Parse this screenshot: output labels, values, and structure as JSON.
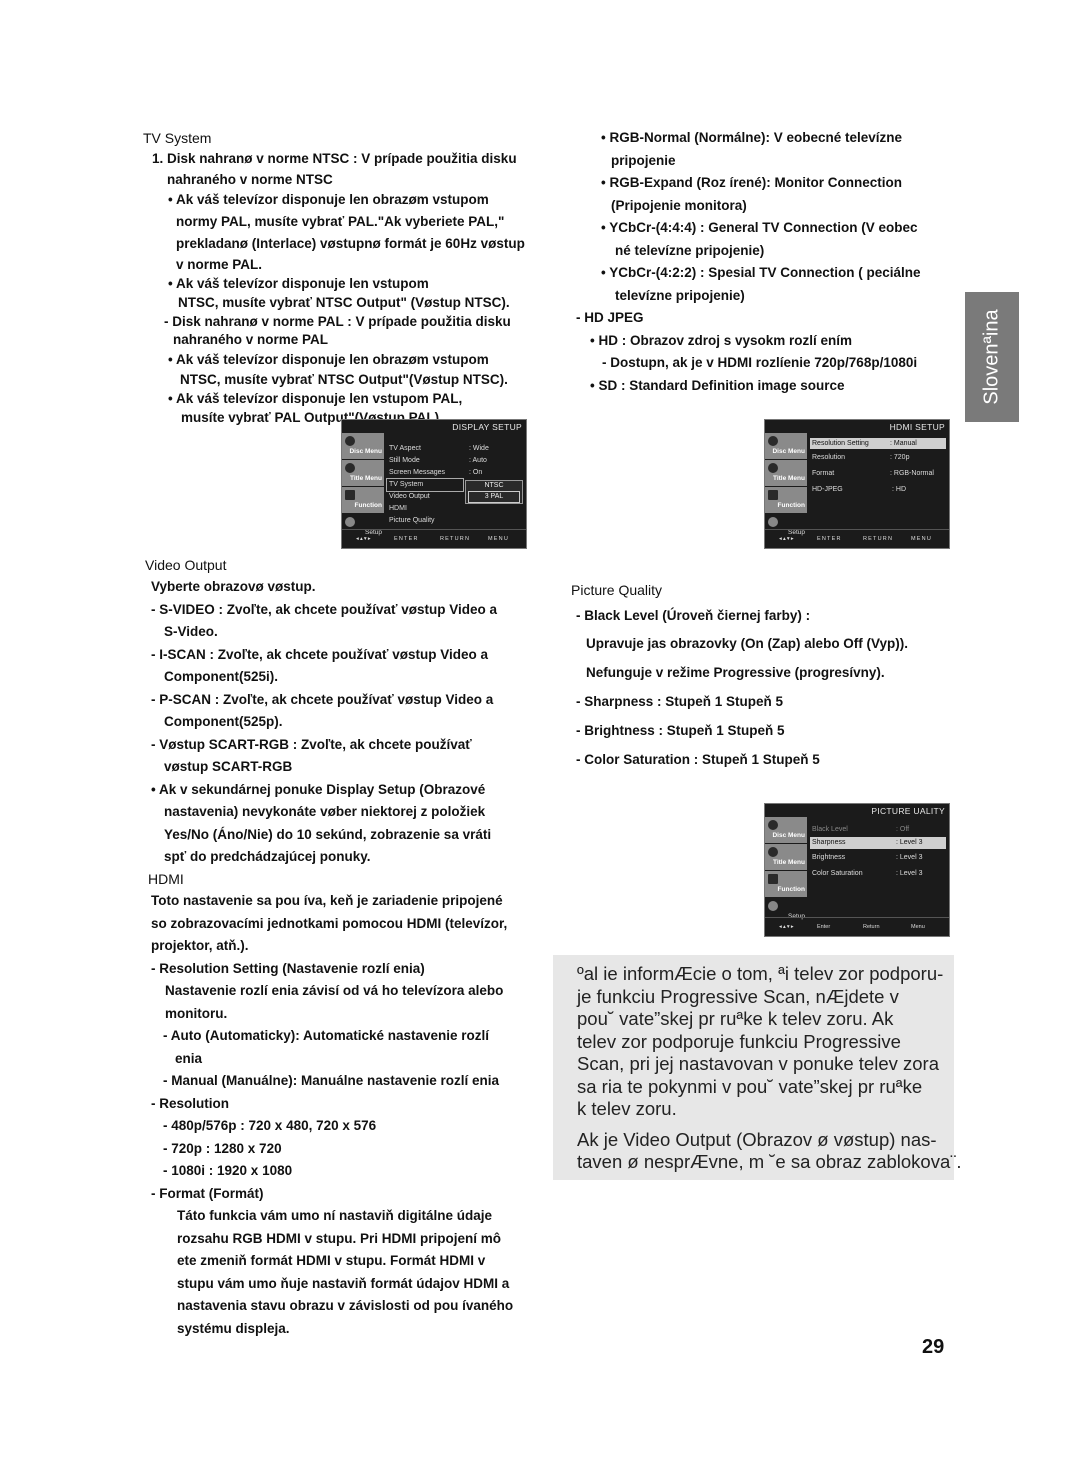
{
  "side_tab": {
    "label": "Slovenªina"
  },
  "page_number": "29",
  "left": {
    "tv_system": {
      "heading": "TV System",
      "lines": [
        "1. Disk nahranø v norme NTSC : V prípade použitia disku",
        "nahraného v norme NTSC",
        "• Ak váš televízor disponuje len obrazøm vstupom",
        "normy PAL, musíte vybrať PAL.\"Ak vyberiete PAL,\"",
        "prekladanø (Interlace) vøstupnø formát je 60Hz vøstup",
        "v norme PAL.",
        "• Ak váš televízor disponuje len vstupom",
        "NTSC, musíte vybrať NTSC Output\" (Vøstup NTSC).",
        "- Disk nahranø v norme PAL : V prípade použitia disku",
        "nahraného v norme PAL",
        "• Ak váš televízor disponuje len obrazøm vstupom",
        "NTSC, musíte vybrať NTSC Output\"(Vøstup NTSC).",
        "• Ak váš televízor disponuje len vstupom PAL,",
        "musíte vybrať PAL Output\"(Vøstup PAL)."
      ]
    },
    "video_output": {
      "heading": "Video Output",
      "lines": [
        "Vyberte obrazovø vøstup.",
        "- S-VIDEO : Zvoľte, ak chcete používať vøstup Video a",
        "S-Video.",
        "- I-SCAN : Zvoľte, ak chcete používať vøstup Video a",
        "Component(525i).",
        "- P-SCAN : Zvoľte, ak chcete používať vøstup Video a",
        "Component(525p).",
        "- Vøstup SCART-RGB : Zvoľte, ak chcete používať",
        "vøstup SCART-RGB",
        "• Ak v sekundárnej ponuke Display Setup (Obrazové",
        "nastavenia) nevykonáte vøber niektorej z položiek",
        "Yes/No (Áno/Nie) do 10 sekúnd, zobrazenie sa vráti",
        "spť do predchádzajúcej ponuky."
      ]
    },
    "hdmi": {
      "heading": "HDMI",
      "lines": [
        "Toto nastavenie sa pou íva, keň je zariadenie pripojené",
        "so zobrazovacími jednotkami pomocou HDMI (televízor,",
        "projektor, atň.).",
        "- Resolution Setting (Nastavenie rozlí enia)",
        "Nastavenie rozlí enia závisí od vá ho televízora alebo",
        "monitoru.",
        "- Auto (Automaticky): Automatické nastavenie rozlí",
        "enia",
        "- Manual (Manuálne): Manuálne nastavenie rozlí enia",
        "- Resolution",
        "- 480p/576p : 720 x 480, 720 x 576",
        "- 720p : 1280 x 720",
        "- 1080i : 1920 x 1080",
        "- Format (Formát)",
        "Táto funkcia vám umo ní nastaviň digitálne údaje",
        "rozsahu RGB HDMI v stupu. Pri HDMI pripojení mô",
        "ete zmeniň formát HDMI v stupu. Formát HDMI v",
        "stupu vám umo ňuje nastaviň formát údajov HDMI a",
        "nastavenia stavu obrazu v závislosti od pou ívaného",
        "systému displeja."
      ]
    }
  },
  "right": {
    "format_options": [
      "• RGB-Normal (Normálne): V eobecné televízne",
      "pripojenie",
      "• RGB-Expand (Roz írené): Monitor Connection",
      "(Pripojenie monitora)",
      "• YCbCr-(4:4:4) : General TV Connection (V eobec",
      "né televízne pripojenie)",
      "• YCbCr-(4:2:2) : Spesial TV Connection ( peciálne",
      "televízne pripojenie)"
    ],
    "hd_jpeg": [
      "- HD JPEG",
      "• HD : Obrazov zdroj s vysokm rozlí ením",
      "- Dostupn, ak je v HDMI rozlíenie 720p/768p/1080i",
      "• SD : Standard Definition image source"
    ],
    "picture_quality": {
      "heading": "Picture Quality",
      "lines": [
        "- Black Level (Úroveň čiernej farby) :",
        "Upravuje jas obrazovky (On (Zap) alebo Off (Vyp)).",
        "Nefunguje v režime Progressive (progresívny).",
        "- Sharpness : Stupeň 1  Stupeň 5",
        "- Brightness : Stupeň 1  Stupeň 5",
        "- Color Saturation : Stupeň 1  Stupeň 5"
      ]
    },
    "note": [
      "ºal ie informÆcie o tom, ªi telev zor podporu-",
      "je funkciu Progressive Scan, nÆjdete v",
      "pou˘ vate”skej pr ruªke k  telev zoru.  Ak",
      "telev zor podporuje funkciu Progressive",
      "Scan, pri jej nastavovan  v ponuke telev zora",
      "sa ria te pokynmi v  pou˘ vate”skej pr ruªke",
      "k telev zoru.",
      "Ak je Video Output (Obrazov  ø vøstup) nas-",
      "taven ø nesprÆvne, m ˘e sa obraz zablokova¨."
    ]
  },
  "menus": {
    "sidebar": [
      "Disc Menu",
      "Title Menu",
      "Function",
      "Setup"
    ],
    "display_setup": {
      "title": "DISPLAY SETUP",
      "rows": [
        {
          "k": "TV Aspect",
          "v": ": Wide"
        },
        {
          "k": "Still Mode",
          "v": ": Auto"
        },
        {
          "k": "Screen Messages",
          "v": ": On"
        },
        {
          "k": "TV System",
          "v": ""
        },
        {
          "k": "Video Output",
          "v": ""
        },
        {
          "k": "HDMI",
          "v": ""
        },
        {
          "k": "Picture Quality",
          "v": ""
        }
      ],
      "popup": [
        "NTSC",
        "3 PAL"
      ],
      "footer": [
        "ENTER",
        "RETURN",
        "MENU"
      ]
    },
    "hdmi_setup": {
      "title": "HDMI SETUP",
      "rows": [
        {
          "k": "Resolution Setting",
          "v": ": Manual"
        },
        {
          "k": "Resolution",
          "v": ": 720p"
        },
        {
          "k": "Format",
          "v": ": RGB-Normal"
        },
        {
          "k": "HD-JPEG",
          "v": ": HD"
        }
      ],
      "footer": [
        "ENTER",
        "RETURN",
        "MENU"
      ]
    },
    "picture_quality": {
      "title": "PICTURE   UALITY",
      "rows": [
        {
          "k": "Black Level",
          "v": ": Off"
        },
        {
          "k": "Sharpness",
          "v": ": Level 3"
        },
        {
          "k": "Brightness",
          "v": ": Level 3"
        },
        {
          "k": "Color Saturation",
          "v": ": Level 3"
        }
      ],
      "footer": [
        "Enter",
        "Return",
        "Menu"
      ]
    }
  }
}
